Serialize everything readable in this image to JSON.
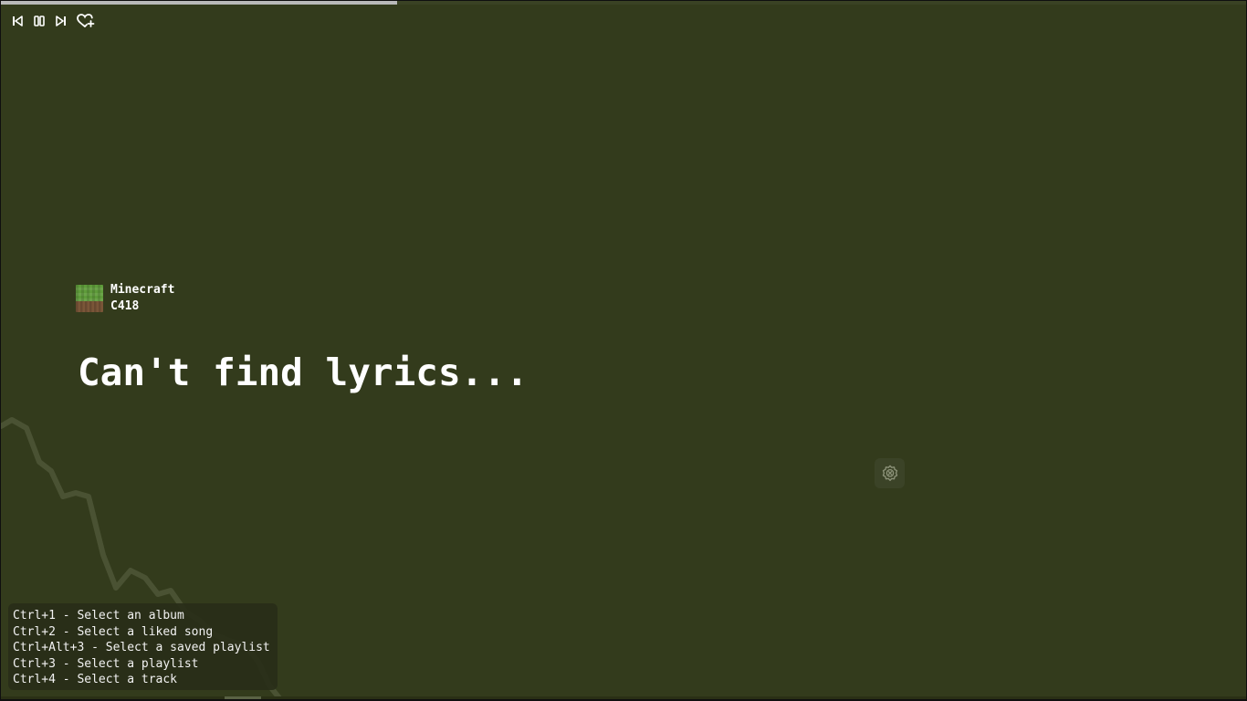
{
  "player": {
    "progress_fraction": 0.318,
    "controls": [
      {
        "name": "previous-icon"
      },
      {
        "name": "pause-icon"
      },
      {
        "name": "next-icon"
      },
      {
        "name": "heart-plus-icon"
      }
    ]
  },
  "track": {
    "title": "Minecraft",
    "artist": "C418"
  },
  "lyrics": {
    "message": "Can't find lyrics..."
  },
  "settings": {
    "icon": "gear-icon"
  },
  "shortcuts": [
    "Ctrl+1 - Select an album",
    "Ctrl+2 - Select a liked song",
    "Ctrl+Alt+3 - Select a saved playlist",
    "Ctrl+3 - Select a playlist",
    "Ctrl+4 - Select a track"
  ],
  "colors": {
    "background": "#333b1c",
    "accent": "#b9b9b9"
  }
}
